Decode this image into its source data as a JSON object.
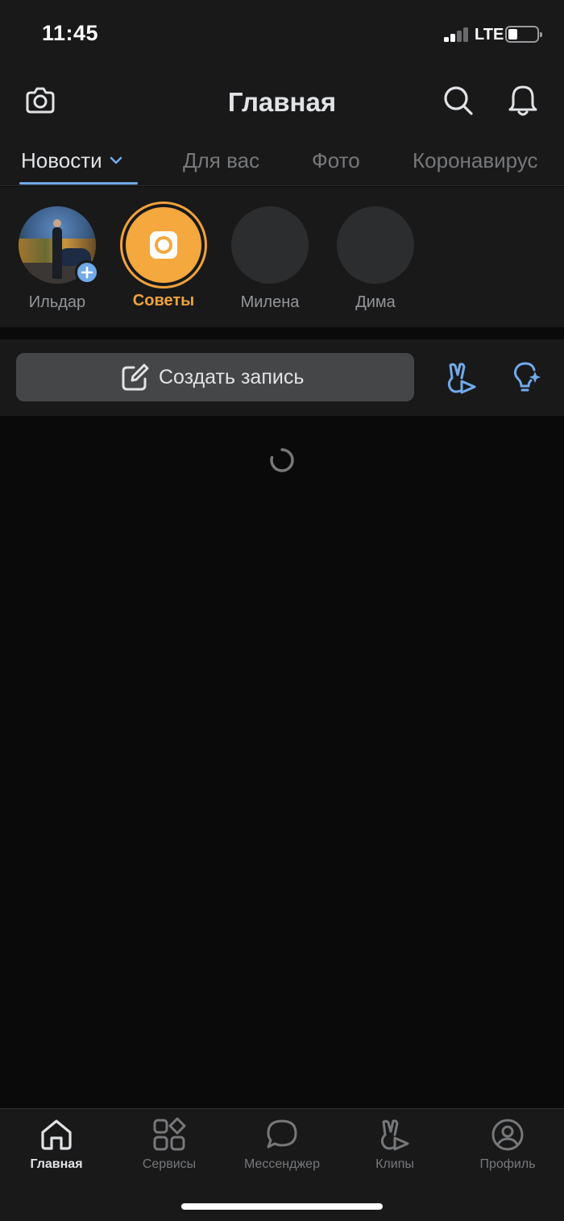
{
  "status_bar": {
    "time": "11:45",
    "network": "LTE"
  },
  "header": {
    "title": "Главная"
  },
  "tabs": [
    {
      "label": "Новости"
    },
    {
      "label": "Для вас"
    },
    {
      "label": "Фото"
    },
    {
      "label": "Коронавирус"
    }
  ],
  "stories": [
    {
      "name": "Ильдар"
    },
    {
      "name": "Советы"
    },
    {
      "name": "Милена"
    },
    {
      "name": "Дима"
    }
  ],
  "composer": {
    "create_label": "Создать запись"
  },
  "bottom_nav": [
    {
      "label": "Главная",
      "icon": "home-icon"
    },
    {
      "label": "Сервисы",
      "icon": "services-icon"
    },
    {
      "label": "Мессенджер",
      "icon": "messenger-icon"
    },
    {
      "label": "Клипы",
      "icon": "clips-icon"
    },
    {
      "label": "Профиль",
      "icon": "profile-icon"
    }
  ],
  "colors": {
    "accent": "#71aaeb",
    "sovety": "#f0a33a",
    "background": "#0a0a0a",
    "surface": "#19191a"
  }
}
